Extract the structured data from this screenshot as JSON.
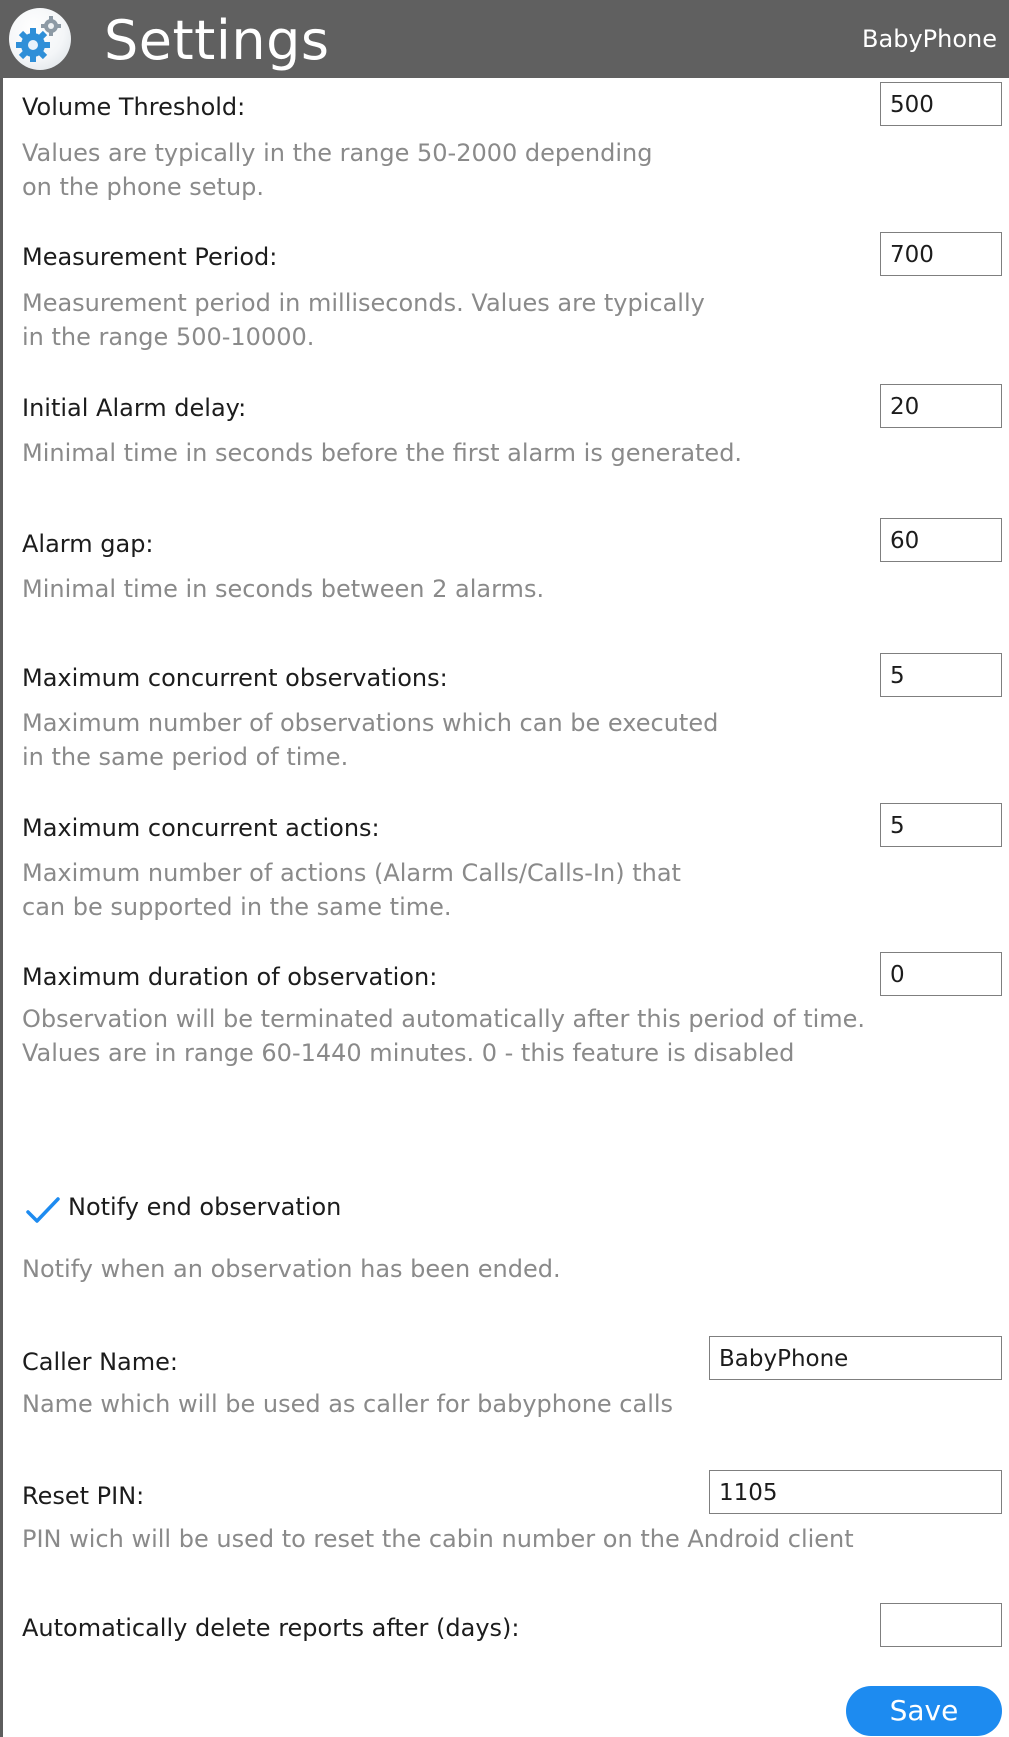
{
  "header": {
    "title": "Settings",
    "app_name": "BabyPhone",
    "logo_icon": "gear-icon"
  },
  "settings": {
    "volume_threshold": {
      "label": "Volume Threshold:",
      "value": "500",
      "description": "Values are typically in the range 50-2000 depending\non the phone setup."
    },
    "measurement_period": {
      "label": "Measurement Period:",
      "value": "700",
      "description": "Measurement period in milliseconds. Values are typically\nin the range 500-10000."
    },
    "initial_alarm_delay": {
      "label": "Initial Alarm delay:",
      "value": "20",
      "description": "Minimal time in seconds before the first alarm is generated."
    },
    "alarm_gap": {
      "label": "Alarm gap:",
      "value": "60",
      "description": "Minimal time in seconds between 2 alarms."
    },
    "max_concurrent_observations": {
      "label": "Maximum concurrent observations:",
      "value": "5",
      "description": "Maximum number of observations which can be executed\nin the same period of time."
    },
    "max_concurrent_actions": {
      "label": "Maximum concurrent actions:",
      "value": "5",
      "description": "Maximum number of actions (Alarm Calls/Calls-In) that\ncan be supported in the same time."
    },
    "max_duration_observation": {
      "label": "Maximum duration of observation:",
      "value": "0",
      "description": "Observation will be terminated automatically after this period of time.\nValues are in range 60-1440 minutes. 0 - this feature is disabled"
    },
    "notify_end_observation": {
      "label": "Notify end observation",
      "checked": true,
      "description": "Notify when an observation has been ended."
    },
    "caller_name": {
      "label": "Caller Name:",
      "value": "BabyPhone",
      "description": "Name which will be used as caller for babyphone calls"
    },
    "reset_pin": {
      "label": "Reset PIN:",
      "value": "1105",
      "description": "PIN wich will be used to reset the cabin number on the Android client"
    },
    "auto_delete_reports": {
      "label": "Automatically delete reports after (days):",
      "value": ""
    }
  },
  "footer": {
    "save_label": "Save"
  },
  "colors": {
    "header_bg": "#606060",
    "accent": "#1d8bf0",
    "description_text": "#8a8a8a"
  }
}
